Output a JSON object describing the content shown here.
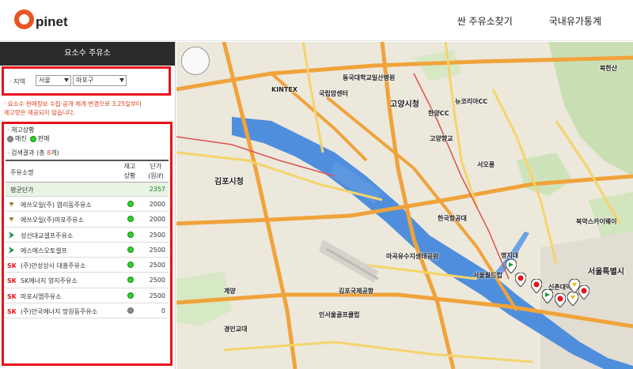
{
  "header": {
    "logo_rest": "pinet",
    "nav": [
      "싼 주유소찾기",
      "국내유가통계"
    ]
  },
  "sidebar": {
    "title": "요소수 주유소",
    "region_label": "· 지역",
    "city": "서울",
    "district": "마포구",
    "notice_line1": "· 요소수 판매정보 수집·공개 체계 변경으로 3.25일부터",
    "notice_line2": "제고량은 제공되지 않습니다.",
    "stock_title": "· 재고상황",
    "legend_soldout": "매진",
    "legend_sale": "판매",
    "result_prefix": "· 검색결과 (총 ",
    "result_count": "8",
    "result_suffix": "개)",
    "col_name": "주유소명",
    "col_stock_1": "재고",
    "col_stock_2": "상황",
    "col_price_1": "단가",
    "col_price_2": "(원/ℓ)",
    "avg_label": "평균단가",
    "avg_price": "2357",
    "stations": [
      {
        "name": "에쓰오일(주) 염리동주유소",
        "brand": "s-oil-icon",
        "status": "판매",
        "price": "2000"
      },
      {
        "name": "에쓰오일(주)마포주유소",
        "brand": "s-oil-icon",
        "status": "판매",
        "price": "2000"
      },
      {
        "name": "성산대교셀프주유소",
        "brand": "gs-caltex-icon",
        "status": "판매",
        "price": "2500"
      },
      {
        "name": "에스에스오토셀프",
        "brand": "gs-caltex-icon",
        "status": "판매",
        "price": "2500"
      },
      {
        "name": "(주)만성상사 대흥주유소",
        "brand": "sk-energy-icon",
        "status": "판매",
        "price": "2500"
      },
      {
        "name": "SK에너지 양지주유소",
        "brand": "sk-energy-icon",
        "status": "판매",
        "price": "2500"
      },
      {
        "name": "마포시엠주유소",
        "brand": "sk-energy-icon",
        "status": "판매",
        "price": "2500"
      },
      {
        "name": "(주)안국에너지 망원동주유소",
        "brand": "sk-energy-icon",
        "status": "매진",
        "price": "0"
      }
    ]
  },
  "colors": {
    "brand_orange": "#e95420",
    "highlight_red": "#e8121a",
    "status_green": "#2fd12a",
    "status_gray": "#8a8a8a",
    "river_blue": "#4f8edc"
  },
  "map": {
    "labels": {
      "goyang": "고양시청",
      "gimpo_city": "김포시청",
      "gimpo_airport": "김포국제공항",
      "seoul_city": "서울특별시",
      "kintex": "KINTEX",
      "gaon": "고양향교",
      "bukhansan": "북한산",
      "airport_2": "인서울골프클럽",
      "myeongji": "명지대",
      "hanguk": "한국항공대",
      "goyang_st": "고양시농",
      "seooreung": "서오릉",
      "seoulworld": "서울월드컵",
      "mapo": "마곡유수지생태공원",
      "gaeyang": "계양",
      "gyeongin": "경인교대",
      "nuri": "뉴코리아CC",
      "dongguk": "동국대학교일산병원",
      "gukrip": "국립암센터",
      "hanyang": "한양CC",
      "sinchon": "신촌대역",
      "bukahn_kai": "북악스카이웨이"
    }
  }
}
